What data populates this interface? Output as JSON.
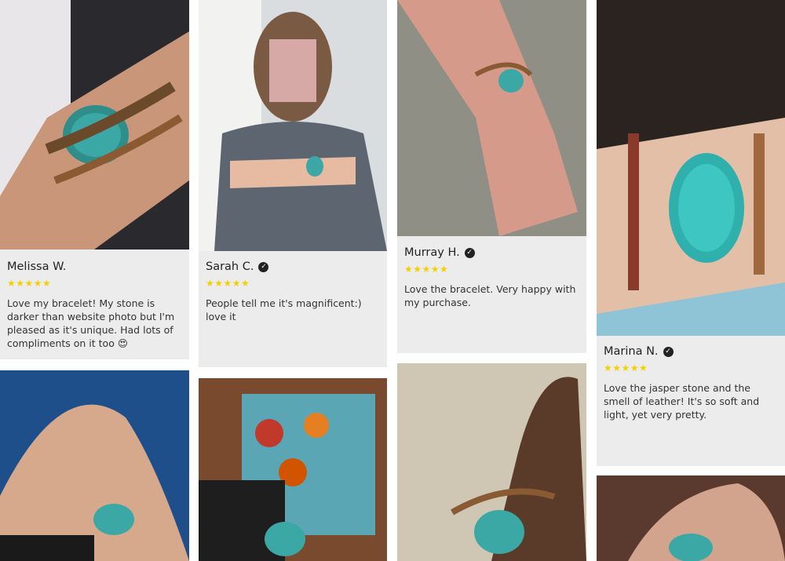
{
  "reviews": [
    {
      "name": "Melissa W.",
      "verified": false,
      "stars": "★★★★★",
      "text": "Love my bracelet! My stone is darker than website photo but I'm pleased as it's unique. Had lots of compliments on it too 😍"
    },
    {
      "name": "Sarah C.",
      "verified": true,
      "stars": "★★★★★",
      "text": "People tell me it's magnificent:) love it"
    },
    {
      "name": "Murray H.",
      "verified": true,
      "stars": "★★★★★",
      "text": "Love the bracelet.  Very happy with my purchase."
    },
    {
      "name": "Marina N.",
      "verified": true,
      "stars": "★★★★★",
      "text": "Love the jasper stone and the smell of leather! It's so soft and light, yet very pretty."
    }
  ],
  "icons": {
    "verified": "check-circle-icon",
    "rating": "star-icon"
  },
  "colors": {
    "star": "#f5d000",
    "card": "#ececec",
    "turquoise": "#3ba8a6"
  }
}
